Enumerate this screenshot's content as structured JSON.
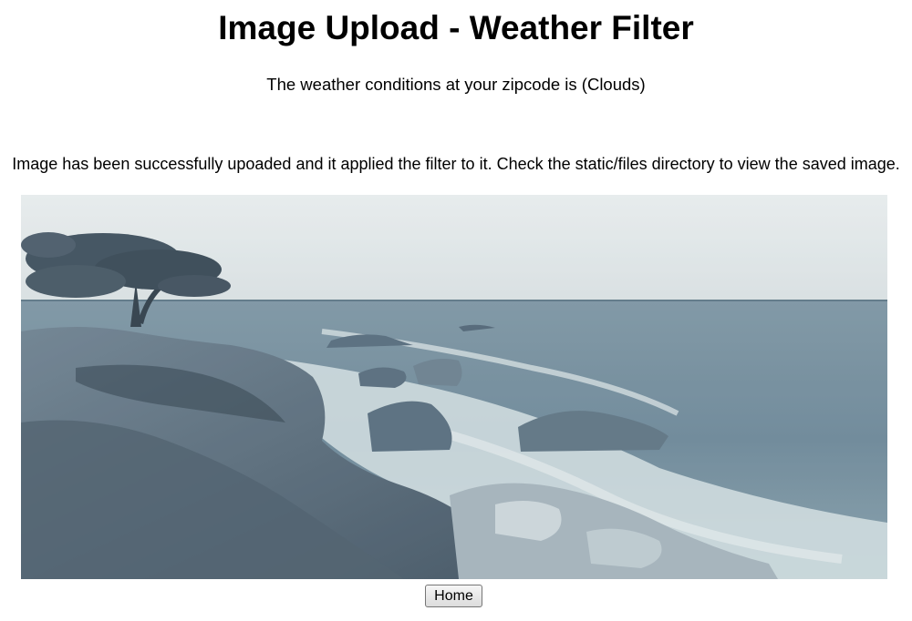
{
  "page": {
    "title": "Image Upload - Weather Filter",
    "weather_text": "The weather conditions at your zipcode is (Clouds)",
    "status_text": "Image has been successfully upoaded and it applied the filter to it. Check the static/files directory to view the saved image.",
    "home_button_label": "Home"
  },
  "image": {
    "subject": "coastal-seascape-photo",
    "filter": "Clouds",
    "tint_color": "#8ea1ad"
  }
}
